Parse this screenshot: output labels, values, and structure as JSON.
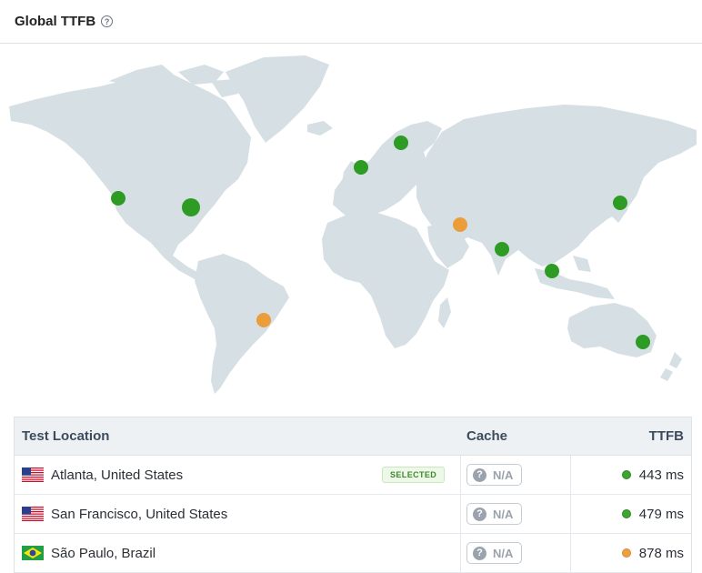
{
  "header": {
    "title": "Global TTFB",
    "help_icon": "question-circle-icon"
  },
  "map": {
    "land_color": "#d5dfe4",
    "markers": [
      {
        "name": "atlanta",
        "status": "fast",
        "color": "#2e9b24",
        "size": "large"
      },
      {
        "name": "san-francisco",
        "status": "fast",
        "color": "#2e9b24",
        "size": "normal"
      },
      {
        "name": "sao-paulo",
        "status": "medium",
        "color": "#eb9d3b",
        "size": "normal"
      },
      {
        "name": "london",
        "status": "fast",
        "color": "#2e9b24",
        "size": "normal"
      },
      {
        "name": "stockholm",
        "status": "fast",
        "color": "#2e9b24",
        "size": "normal"
      },
      {
        "name": "dubai",
        "status": "medium",
        "color": "#eb9d3b",
        "size": "normal"
      },
      {
        "name": "mumbai",
        "status": "fast",
        "color": "#2e9b24",
        "size": "normal"
      },
      {
        "name": "singapore",
        "status": "fast",
        "color": "#2e9b24",
        "size": "normal"
      },
      {
        "name": "tokyo",
        "status": "fast",
        "color": "#2e9b24",
        "size": "normal"
      },
      {
        "name": "sydney",
        "status": "fast",
        "color": "#2e9b24",
        "size": "normal"
      }
    ]
  },
  "table": {
    "headers": {
      "location": "Test Location",
      "cache": "Cache",
      "ttfb": "TTFB"
    },
    "rows": [
      {
        "flag": "us-flag-icon",
        "location": "Atlanta, United States",
        "badge": "SELECTED",
        "cache": "N/A",
        "ttfb": "443 ms",
        "status": "green"
      },
      {
        "flag": "us-flag-icon",
        "location": "San Francisco, United States",
        "badge": "",
        "cache": "N/A",
        "ttfb": "479 ms",
        "status": "green"
      },
      {
        "flag": "brazil-flag-icon",
        "location": "São Paulo, Brazil",
        "badge": "",
        "cache": "N/A",
        "ttfb": "878 ms",
        "status": "orange"
      }
    ]
  }
}
